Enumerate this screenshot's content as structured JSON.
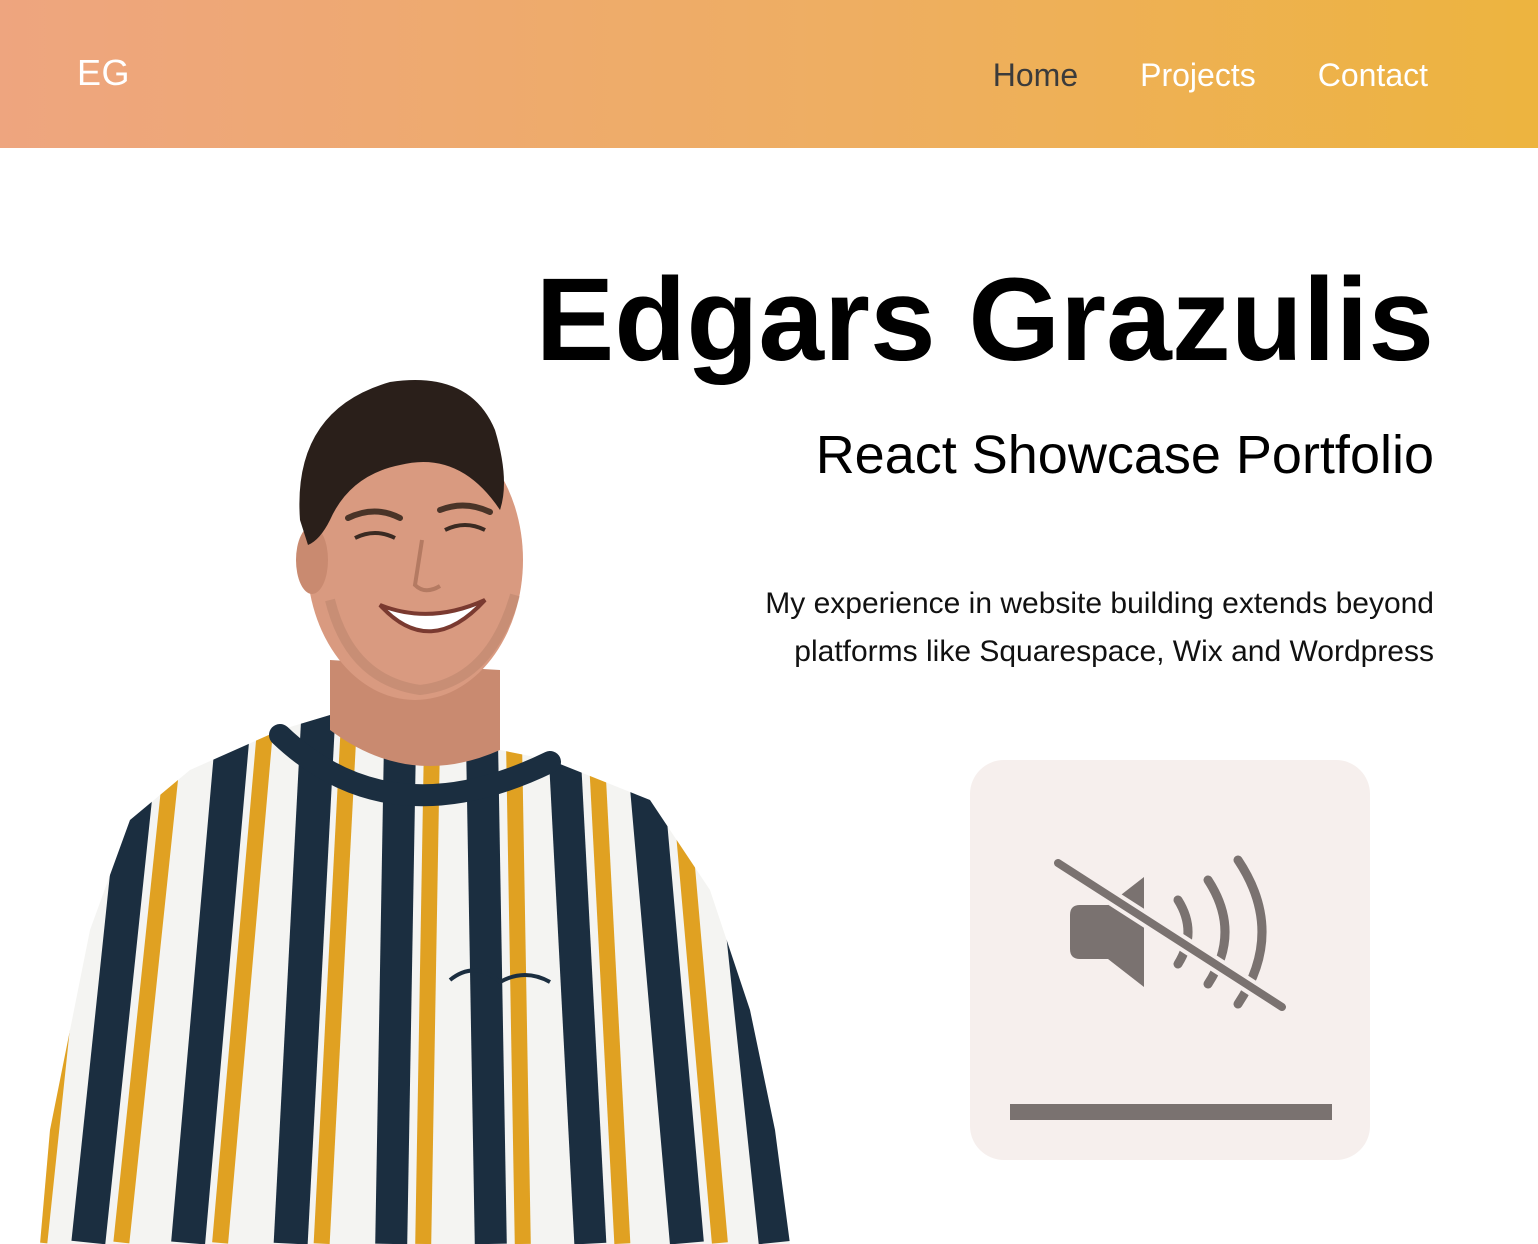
{
  "navbar": {
    "logo": "EG",
    "links": [
      {
        "label": "Home"
      },
      {
        "label": "Projects"
      },
      {
        "label": "Contact"
      }
    ],
    "gradient_start": "#eea57f",
    "gradient_end": "#edb43f",
    "active_link_color": "#3b3b3b"
  },
  "hero": {
    "name": "Edgars Grazulis",
    "subtitle": "React Showcase Portfolio",
    "description": "My experience in website building extends beyond platforms like Squarespace, Wix and Wordpress"
  },
  "sound_toggle": {
    "icon": "speaker-muted-icon",
    "card_color": "#f6efed",
    "icon_color": "#7a7270",
    "volume_level": 1.0
  },
  "photo": {
    "shirt_colors": [
      "#1b2e40",
      "#e0a122",
      "#f4f4f2"
    ]
  }
}
